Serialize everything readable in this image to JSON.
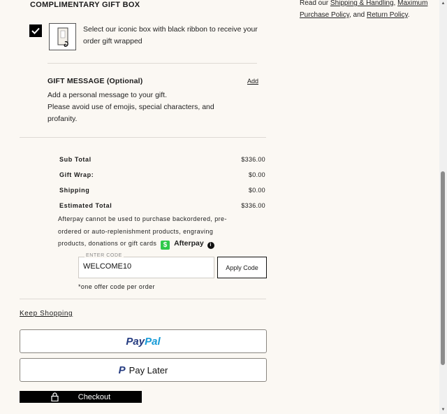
{
  "gift_box": {
    "title": "COMPLIMENTARY GIFT BOX",
    "checked": true,
    "description": "Select our iconic box with black ribbon to receive your order gift wrapped"
  },
  "gift_message": {
    "title": "GIFT MESSAGE (Optional)",
    "add_label": "Add",
    "line1": "Add a personal message to your gift.",
    "line2": "Please avoid use of emojis, special characters, and profanity."
  },
  "summary": {
    "rows": [
      {
        "label": "Sub Total",
        "value": "$336.00"
      },
      {
        "label": "Gift Wrap:",
        "value": "$0.00"
      },
      {
        "label": "Shipping",
        "value": "$0.00"
      },
      {
        "label": "Estimated Total",
        "value": "$336.00"
      }
    ]
  },
  "afterpay": {
    "note": "Afterpay cannot be used to purchase backordered, pre-ordered or auto-replenishment products, engraving products, donations or gift cards",
    "badge": "$",
    "brand": "Afterpay",
    "info": "i"
  },
  "promo": {
    "label": "ENTER CODE",
    "value": "WELCOME10",
    "apply_label": "Apply Code",
    "note": "*one offer code per order"
  },
  "actions": {
    "keep_shopping": "Keep Shopping",
    "paypal_part1": "Pay",
    "paypal_part2": "Pal",
    "pay_later_mark": "P",
    "pay_later": "Pay Later",
    "checkout": "Checkout"
  },
  "sidebar": {
    "prefix": "Read our ",
    "link1": "Shipping & Handling",
    "sep1": ",",
    "link2": "Maximum Purchase Policy",
    "sep2": ", and ",
    "link3": "Return Policy",
    "suffix": "."
  },
  "colors": {
    "background": "#fbf8f3",
    "afterpay_green": "#2fc94b",
    "paypal_dark": "#253b80",
    "paypal_light": "#179bd7"
  }
}
